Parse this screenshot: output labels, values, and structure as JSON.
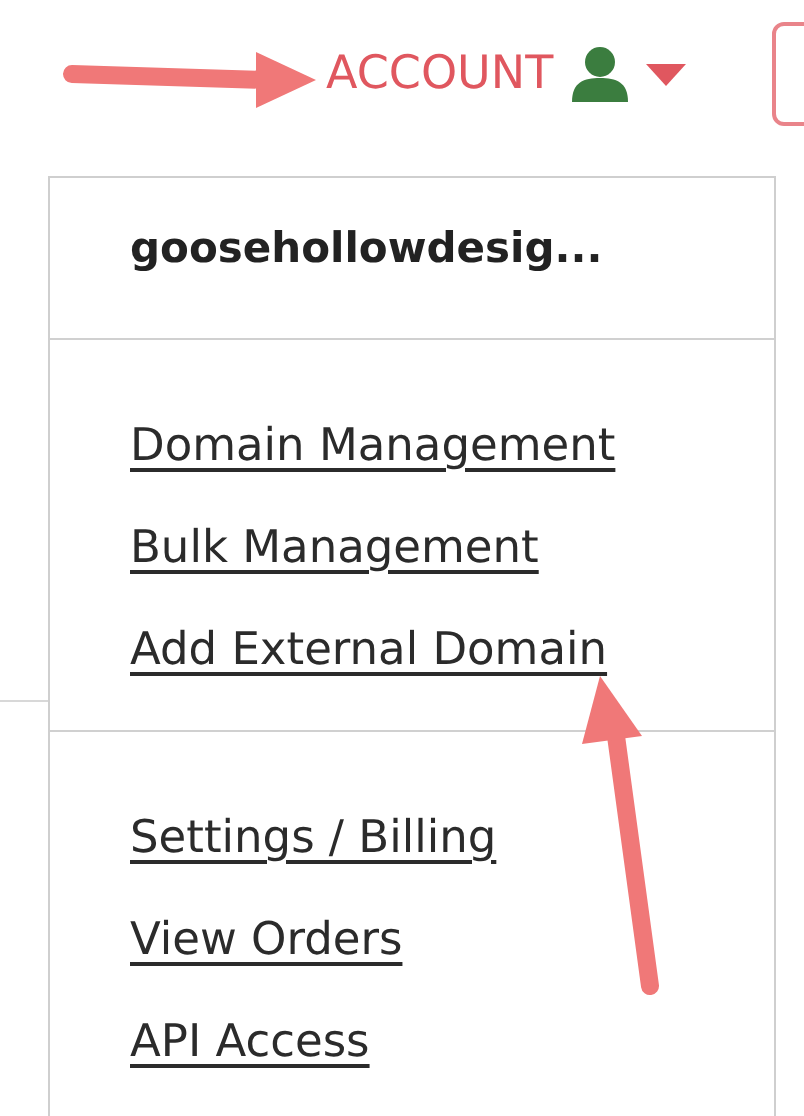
{
  "header": {
    "account_label": "ACCOUNT"
  },
  "menu": {
    "username": "goosehollowdesig...",
    "sections": [
      {
        "links": [
          {
            "label": "Domain Management"
          },
          {
            "label": "Bulk Management"
          },
          {
            "label": "Add External Domain"
          }
        ]
      },
      {
        "links": [
          {
            "label": "Settings / Billing"
          },
          {
            "label": "View Orders"
          },
          {
            "label": "API Access"
          }
        ]
      }
    ]
  }
}
